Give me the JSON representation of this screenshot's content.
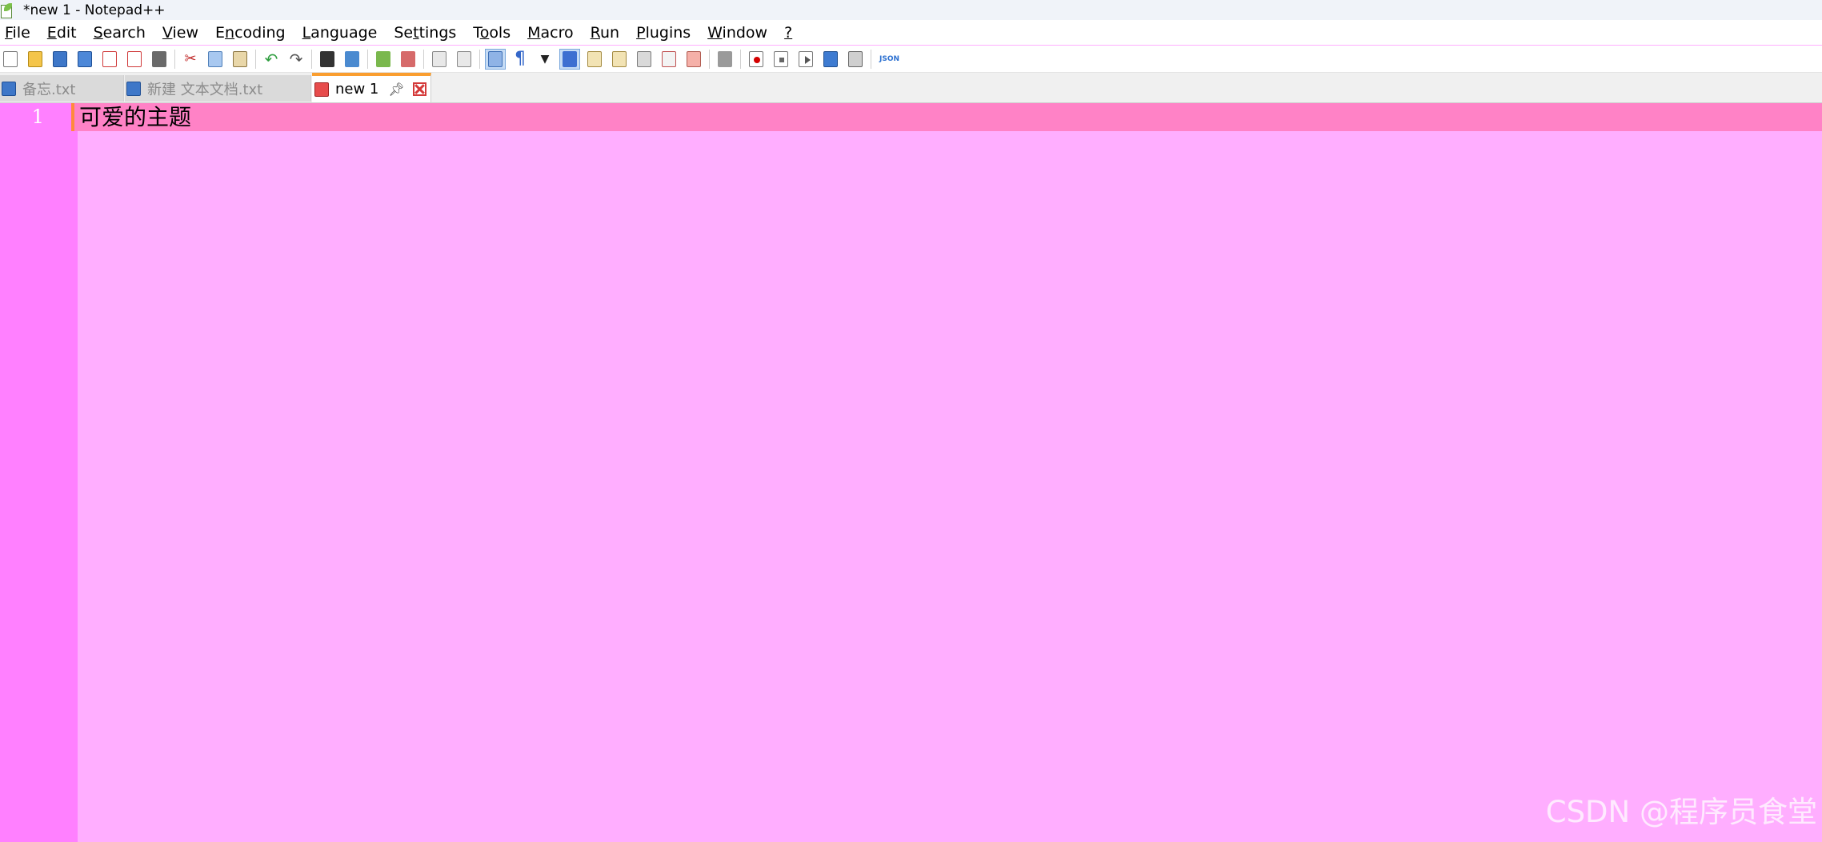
{
  "window": {
    "title": "*new 1 - Notepad++",
    "icon": "notepadpp-icon"
  },
  "menu": [
    {
      "pre": "",
      "acc": "F",
      "post": "ile"
    },
    {
      "pre": "",
      "acc": "E",
      "post": "dit"
    },
    {
      "pre": "",
      "acc": "S",
      "post": "earch"
    },
    {
      "pre": "",
      "acc": "V",
      "post": "iew"
    },
    {
      "pre": "E",
      "acc": "n",
      "post": "coding"
    },
    {
      "pre": "",
      "acc": "L",
      "post": "anguage"
    },
    {
      "pre": "Se",
      "acc": "t",
      "post": "tings"
    },
    {
      "pre": "T",
      "acc": "o",
      "post": "ols"
    },
    {
      "pre": "",
      "acc": "M",
      "post": "acro"
    },
    {
      "pre": "",
      "acc": "R",
      "post": "un"
    },
    {
      "pre": "",
      "acc": "P",
      "post": "lugins"
    },
    {
      "pre": "",
      "acc": "W",
      "post": "indow"
    },
    {
      "pre": "",
      "acc": "?",
      "post": ""
    }
  ],
  "toolbar": {
    "buttons": [
      "new",
      "open",
      "save",
      "save-all",
      "close",
      "close-all",
      "print",
      "cut",
      "copy",
      "paste",
      "undo",
      "redo",
      "find",
      "replace",
      "zoom-in",
      "zoom-out",
      "sync-vertical",
      "sync-horizontal",
      "word-wrap",
      "show-all-characters",
      "dropdown",
      "indent-guide",
      "user-defined-language",
      "document-map",
      "document-list",
      "function-list",
      "folder-as-workspace",
      "monitoring",
      "record-macro",
      "stop-recording",
      "playback-macro",
      "run-macro-multiple",
      "save-macro",
      "json-viewer"
    ],
    "json_label": "JSON"
  },
  "tabs": [
    {
      "label": "备忘.txt",
      "state": "inactive"
    },
    {
      "label": "新建 文本文档.txt",
      "state": "inactive"
    },
    {
      "label": "new 1",
      "state": "active"
    }
  ],
  "editor": {
    "line_number": "1",
    "line_text": "可爱的主题",
    "colors": {
      "background": "#ffaeff",
      "gutter": "#ff80ff",
      "current_line": "#ff82c6",
      "caret_marker": "#ff8a3b",
      "line_number": "#ffffff"
    }
  },
  "watermark": "CSDN @程序员食堂"
}
